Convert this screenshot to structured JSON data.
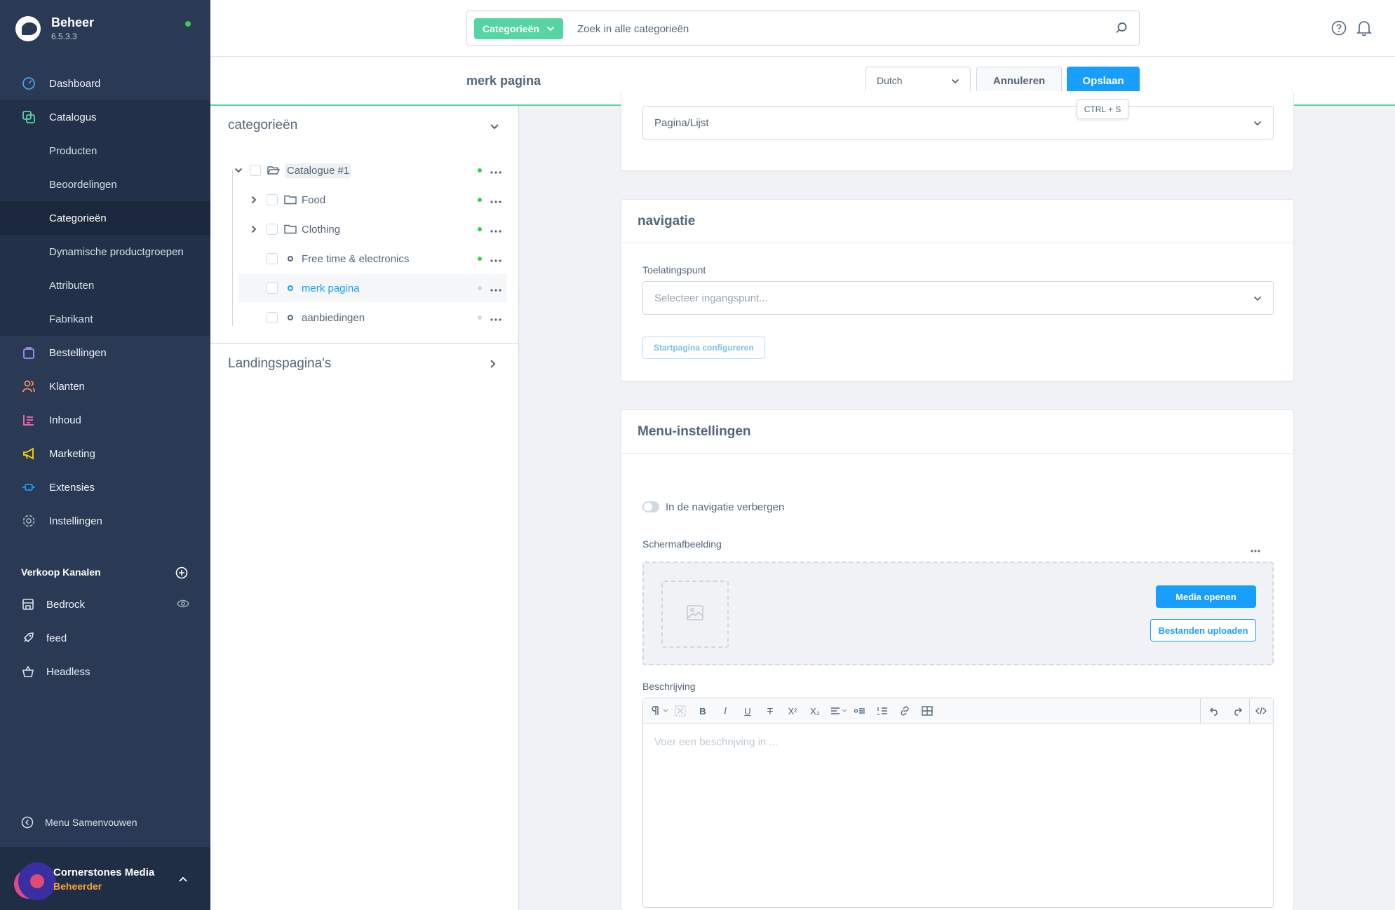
{
  "app": {
    "name": "Beheer",
    "version": "6.5.3.3",
    "status_color": "#37d046"
  },
  "sidebar": {
    "items": [
      {
        "label": "Dashboard",
        "icon": "dashboard-icon",
        "color": "#4a9ee6"
      },
      {
        "label": "Catalogus",
        "icon": "catalog-icon",
        "color": "#57d4a4",
        "active": true
      },
      {
        "label": "Bestellingen",
        "icon": "orders-icon",
        "color": "#a092f0"
      },
      {
        "label": "Klanten",
        "icon": "customers-icon",
        "color": "#f88962"
      },
      {
        "label": "Inhoud",
        "icon": "content-icon",
        "color": "#ff68b4"
      },
      {
        "label": "Marketing",
        "icon": "marketing-icon",
        "color": "#ffd700"
      },
      {
        "label": "Extensies",
        "icon": "extensions-icon",
        "color": "#189eff"
      },
      {
        "label": "Instellingen",
        "icon": "settings-icon",
        "color": "#9aa8b5"
      }
    ],
    "catalog_subitems": [
      {
        "label": "Producten"
      },
      {
        "label": "Beoordelingen"
      },
      {
        "label": "Categorieën",
        "active": true
      },
      {
        "label": "Dynamische productgroepen"
      },
      {
        "label": "Attributen"
      },
      {
        "label": "Fabrikant"
      }
    ],
    "sales_channels_title": "Verkoop Kanalen",
    "sales_channels": [
      {
        "label": "Bedrock",
        "icon": "storefront-icon"
      },
      {
        "label": "feed",
        "icon": "rocket-icon"
      },
      {
        "label": "Headless",
        "icon": "basket-icon"
      }
    ],
    "collapse_label": "Menu Samenvouwen",
    "user": {
      "name": "Cornerstones Media",
      "role": "Beheerder"
    }
  },
  "search": {
    "type_label": "Categorieën",
    "placeholder": "Zoek in alle categorieën",
    "accent": "#57d4a4"
  },
  "smartbar": {
    "title": "merk pagina",
    "language": "Dutch",
    "cancel_label": "Annuleren",
    "save_label": "Opslaan",
    "save_tooltip": "CTRL + S",
    "save_color": "#189eff"
  },
  "tree": {
    "title": "categorieën",
    "rows": [
      {
        "label": "Catalogue #1",
        "kind": "root",
        "status": "on"
      },
      {
        "label": "Food",
        "kind": "folder",
        "status": "on"
      },
      {
        "label": "Clothing",
        "kind": "folder",
        "status": "on"
      },
      {
        "label": "Free time & electronics",
        "kind": "leaf",
        "status": "on"
      },
      {
        "label": "merk pagina",
        "kind": "leaf",
        "status": "off",
        "selected": true
      },
      {
        "label": "aanbiedingen",
        "kind": "leaf",
        "status": "off"
      }
    ],
    "landing_title": "Landingspagina's"
  },
  "layout_card": {
    "type_value": "Pagina/Lijst"
  },
  "navigation_card": {
    "title": "navigatie",
    "entry_label": "Toelatingspunt",
    "entry_placeholder": "Selecteer ingangspunt...",
    "configure_label": "Startpagina configureren"
  },
  "menu_card": {
    "title": "Menu-instellingen",
    "hide_label": "In de navigatie verbergen",
    "image_label": "Schermafbeelding",
    "media_open_label": "Media openen",
    "upload_label": "Bestanden uploaden",
    "description_label": "Beschrijving",
    "description_placeholder": "Voer een beschrijving in ..."
  }
}
